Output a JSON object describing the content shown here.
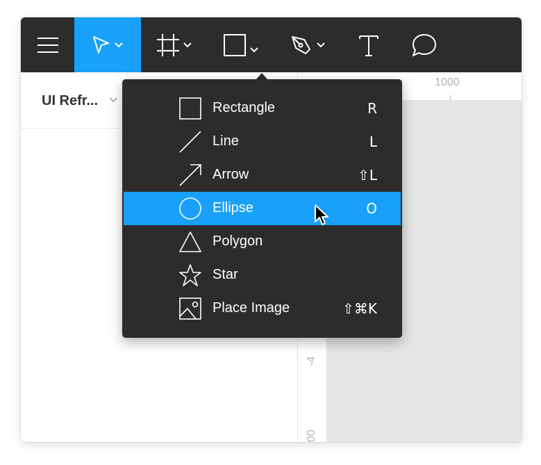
{
  "toolbar": {
    "tools": [
      {
        "name": "main-menu",
        "icon": "hamburger-icon"
      },
      {
        "name": "move-tool",
        "icon": "pointer-icon",
        "active": true
      },
      {
        "name": "frame-tool",
        "icon": "frame-icon"
      },
      {
        "name": "shape-tool",
        "icon": "rectangle-icon"
      },
      {
        "name": "pen-tool",
        "icon": "pen-icon"
      },
      {
        "name": "text-tool",
        "icon": "text-icon"
      },
      {
        "name": "comment-tool",
        "icon": "comment-icon"
      }
    ],
    "accent_color": "#18a0fb",
    "background_color": "#2c2c2c"
  },
  "left_panel": {
    "page_title": "UI Refr..."
  },
  "rulers": {
    "top_label": "1000",
    "left_label_1": "-4",
    "left_label_2": "00"
  },
  "shape_menu": {
    "items": [
      {
        "label": "Rectangle",
        "shortcut": "R",
        "icon": "rectangle-icon"
      },
      {
        "label": "Line",
        "shortcut": "L",
        "icon": "line-icon"
      },
      {
        "label": "Arrow",
        "shortcut": "⇧L",
        "icon": "arrow-icon"
      },
      {
        "label": "Ellipse",
        "shortcut": "O",
        "icon": "ellipse-icon",
        "highlighted": true
      },
      {
        "label": "Polygon",
        "shortcut": "",
        "icon": "polygon-icon"
      },
      {
        "label": "Star",
        "shortcut": "",
        "icon": "star-icon"
      },
      {
        "label": "Place Image",
        "shortcut": "⇧⌘K",
        "icon": "image-icon"
      }
    ]
  }
}
